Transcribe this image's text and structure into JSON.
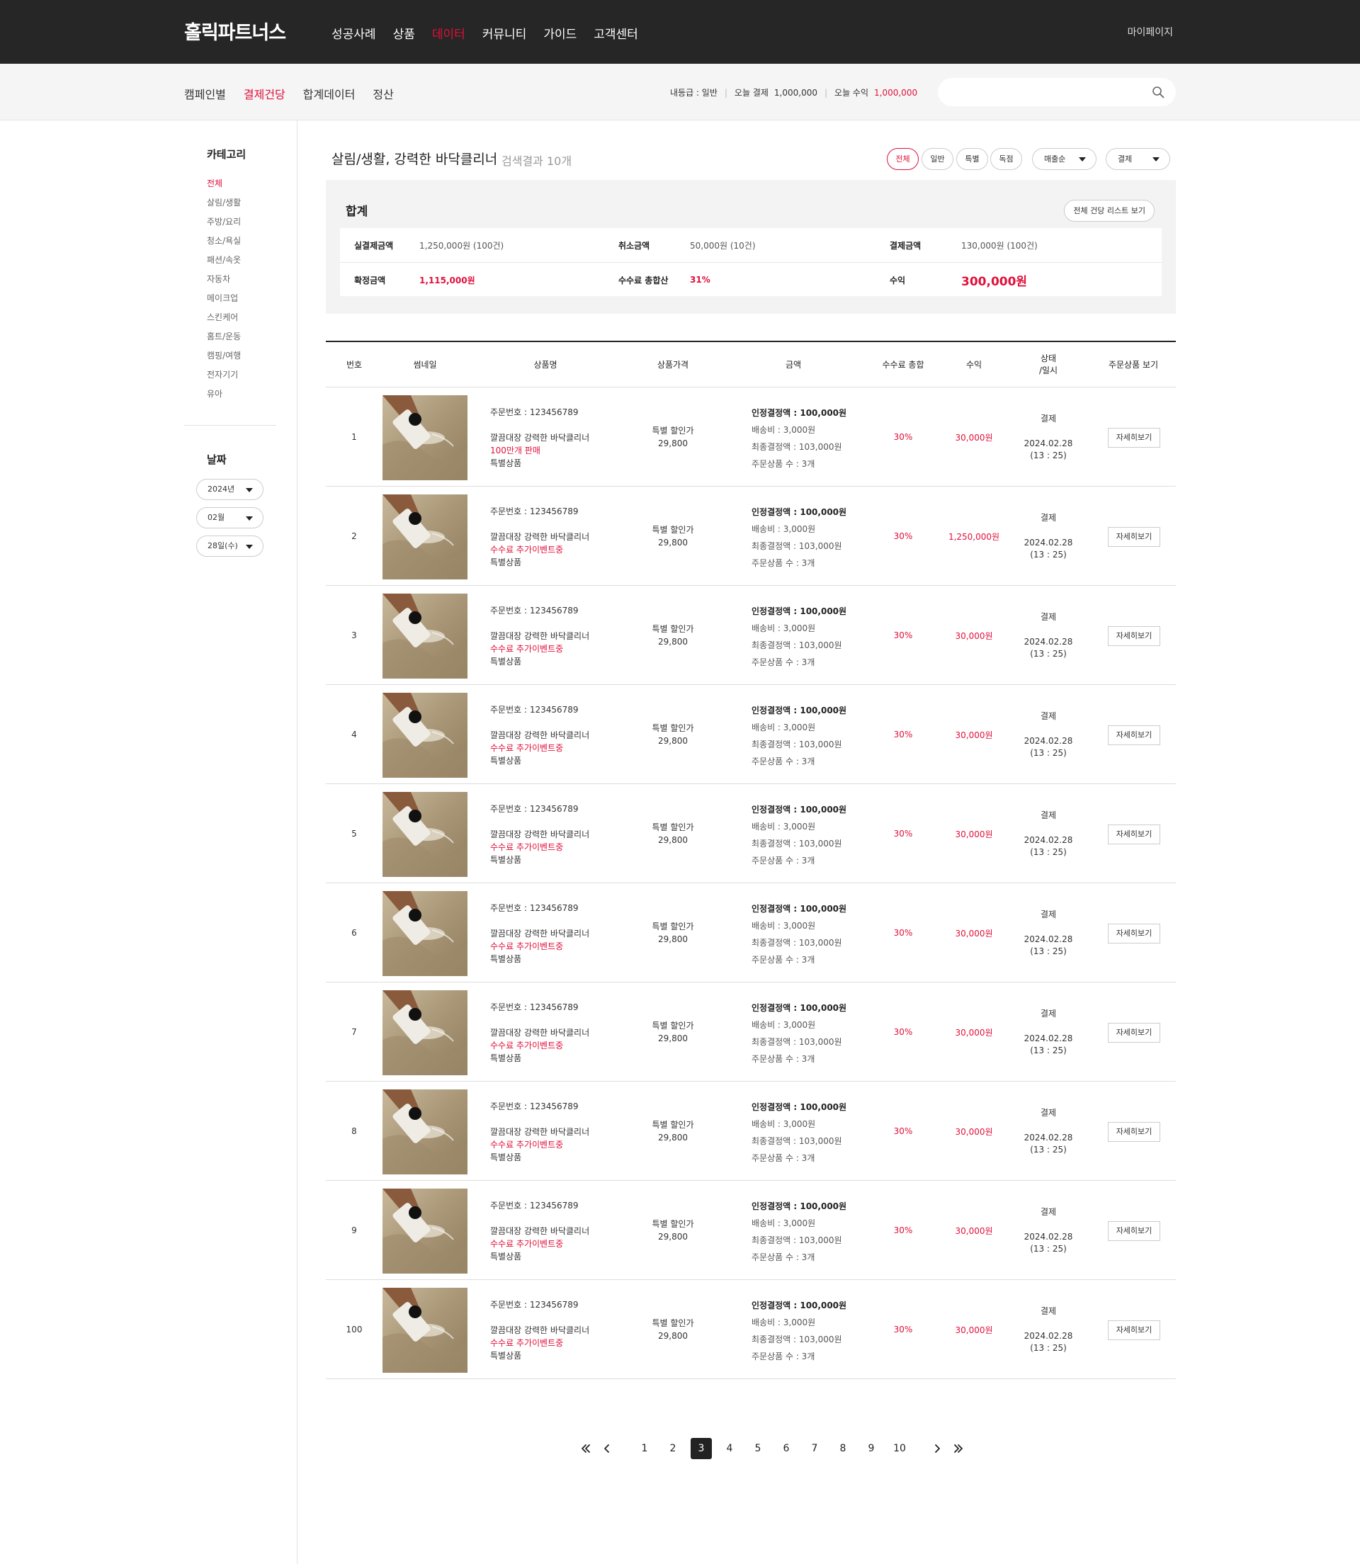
{
  "header": {
    "logo": "홀릭파트너스",
    "nav": [
      "성공사례",
      "상품",
      "데이터",
      "커뮤니티",
      "가이드",
      "고객센터"
    ],
    "active_nav": "데이터",
    "mypage": "마이페이지"
  },
  "subnav": {
    "tabs": [
      "캠페인별",
      "결제건당",
      "합계데이터",
      "정산"
    ],
    "active_tab": "결제건당",
    "grade_label": "내등급 : 일반",
    "payment_label": "오늘 결제",
    "payment_value": "1,000,000",
    "profit_label": "오늘 수익",
    "profit_value": "1,000,000",
    "search_placeholder": ""
  },
  "sidebar": {
    "category_title": "카테고리",
    "categories": [
      "전체",
      "살림/생활",
      "주방/요리",
      "청소/욕실",
      "패션/속옷",
      "자동차",
      "메이크업",
      "스킨케어",
      "홈트/운동",
      "캠핑/여행",
      "전자기기",
      "유아"
    ],
    "active_category": "전체",
    "date_title": "날짜",
    "year": "2024년",
    "month": "02월",
    "day": "28일(수)"
  },
  "main": {
    "title": "살림/생활, 강력한 바닥클리너",
    "result_count": "검색결과 10개",
    "filter_chips": [
      "전체",
      "일반",
      "특별",
      "독점"
    ],
    "active_chip": "전체",
    "sort_select": "매출순",
    "status_select": "결제"
  },
  "summary": {
    "title": "합계",
    "view_all_button": "전체 건당 리스트 보기",
    "actual_payment_label": "실결제금액",
    "actual_payment_value": "1,250,000원 (100건)",
    "cancel_label": "취소금액",
    "cancel_value": "50,000원 (10건)",
    "payment_label": "결제금액",
    "payment_value": "130,000원 (100건)",
    "confirmed_label": "확정금액",
    "confirmed_value": "1,115,000원",
    "commission_label": "수수료 총합산",
    "commission_value": "31%",
    "profit_label": "수익",
    "profit_value": "300,000원"
  },
  "table": {
    "headers": [
      "번호",
      "썸네일",
      "상품명",
      "상품가격",
      "금액",
      "수수료 총합",
      "수익",
      "상태\n/일시",
      "주문상품 보기"
    ],
    "rows": [
      {
        "no": "1",
        "order": "주문번호 : 123456789",
        "name": "깔끔대장 강력한 바닥클리너",
        "note": "100만개 판매",
        "type": "특별상품",
        "price_label": "특별 할인가",
        "price": "29,800",
        "approved_label": "인정결정액 : ",
        "approved": "100,000원",
        "shipping": "배송비 : 3,000원",
        "final": "최종결정액 : 103,000원",
        "qty": "주문상품 수 : 3개",
        "commission": "30%",
        "profit": "30,000원",
        "status": "결제",
        "date": "2024.02.28",
        "time": "(13 : 25)",
        "detail": "자세히보기"
      },
      {
        "no": "2",
        "order": "주문번호 : 123456789",
        "name": "깔끔대장 강력한 바닥클리너",
        "note": "수수료 추가이벤트중",
        "type": "특별상품",
        "price_label": "특별 할인가",
        "price": "29,800",
        "approved_label": "인정결정액 : ",
        "approved": "100,000원",
        "shipping": "배송비 : 3,000원",
        "final": "최종결정액 : 103,000원",
        "qty": "주문상품 수 : 3개",
        "commission": "30%",
        "profit": "1,250,000원",
        "status": "결제",
        "date": "2024.02.28",
        "time": "(13 : 25)",
        "detail": "자세히보기"
      },
      {
        "no": "3",
        "order": "주문번호 : 123456789",
        "name": "깔끔대장 강력한 바닥클리너",
        "note": "수수료 추가이벤트중",
        "type": "특별상품",
        "price_label": "특별 할인가",
        "price": "29,800",
        "approved_label": "인정결정액 : ",
        "approved": "100,000원",
        "shipping": "배송비 : 3,000원",
        "final": "최종결정액 : 103,000원",
        "qty": "주문상품 수 : 3개",
        "commission": "30%",
        "profit": "30,000원",
        "status": "결제",
        "date": "2024.02.28",
        "time": "(13 : 25)",
        "detail": "자세히보기"
      },
      {
        "no": "4",
        "order": "주문번호 : 123456789",
        "name": "깔끔대장 강력한 바닥클리너",
        "note": "수수료 추가이벤트중",
        "type": "특별상품",
        "price_label": "특별 할인가",
        "price": "29,800",
        "approved_label": "인정결정액 : ",
        "approved": "100,000원",
        "shipping": "배송비 : 3,000원",
        "final": "최종결정액 : 103,000원",
        "qty": "주문상품 수 : 3개",
        "commission": "30%",
        "profit": "30,000원",
        "status": "결제",
        "date": "2024.02.28",
        "time": "(13 : 25)",
        "detail": "자세히보기"
      },
      {
        "no": "5",
        "order": "주문번호 : 123456789",
        "name": "깔끔대장 강력한 바닥클리너",
        "note": "수수료 추가이벤트중",
        "type": "특별상품",
        "price_label": "특별 할인가",
        "price": "29,800",
        "approved_label": "인정결정액 : ",
        "approved": "100,000원",
        "shipping": "배송비 : 3,000원",
        "final": "최종결정액 : 103,000원",
        "qty": "주문상품 수 : 3개",
        "commission": "30%",
        "profit": "30,000원",
        "status": "결제",
        "date": "2024.02.28",
        "time": "(13 : 25)",
        "detail": "자세히보기"
      },
      {
        "no": "6",
        "order": "주문번호 : 123456789",
        "name": "깔끔대장 강력한 바닥클리너",
        "note": "수수료 추가이벤트중",
        "type": "특별상품",
        "price_label": "특별 할인가",
        "price": "29,800",
        "approved_label": "인정결정액 : ",
        "approved": "100,000원",
        "shipping": "배송비 : 3,000원",
        "final": "최종결정액 : 103,000원",
        "qty": "주문상품 수 : 3개",
        "commission": "30%",
        "profit": "30,000원",
        "status": "결제",
        "date": "2024.02.28",
        "time": "(13 : 25)",
        "detail": "자세히보기"
      },
      {
        "no": "7",
        "order": "주문번호 : 123456789",
        "name": "깔끔대장 강력한 바닥클리너",
        "note": "수수료 추가이벤트중",
        "type": "특별상품",
        "price_label": "특별 할인가",
        "price": "29,800",
        "approved_label": "인정결정액 : ",
        "approved": "100,000원",
        "shipping": "배송비 : 3,000원",
        "final": "최종결정액 : 103,000원",
        "qty": "주문상품 수 : 3개",
        "commission": "30%",
        "profit": "30,000원",
        "status": "결제",
        "date": "2024.02.28",
        "time": "(13 : 25)",
        "detail": "자세히보기"
      },
      {
        "no": "8",
        "order": "주문번호 : 123456789",
        "name": "깔끔대장 강력한 바닥클리너",
        "note": "수수료 추가이벤트중",
        "type": "특별상품",
        "price_label": "특별 할인가",
        "price": "29,800",
        "approved_label": "인정결정액 : ",
        "approved": "100,000원",
        "shipping": "배송비 : 3,000원",
        "final": "최종결정액 : 103,000원",
        "qty": "주문상품 수 : 3개",
        "commission": "30%",
        "profit": "30,000원",
        "status": "결제",
        "date": "2024.02.28",
        "time": "(13 : 25)",
        "detail": "자세히보기"
      },
      {
        "no": "9",
        "order": "주문번호 : 123456789",
        "name": "깔끔대장 강력한 바닥클리너",
        "note": "수수료 추가이벤트중",
        "type": "특별상품",
        "price_label": "특별 할인가",
        "price": "29,800",
        "approved_label": "인정결정액 : ",
        "approved": "100,000원",
        "shipping": "배송비 : 3,000원",
        "final": "최종결정액 : 103,000원",
        "qty": "주문상품 수 : 3개",
        "commission": "30%",
        "profit": "30,000원",
        "status": "결제",
        "date": "2024.02.28",
        "time": "(13 : 25)",
        "detail": "자세히보기"
      },
      {
        "no": "100",
        "order": "주문번호 : 123456789",
        "name": "깔끔대장 강력한 바닥클리너",
        "note": "수수료 추가이벤트중",
        "type": "특별상품",
        "price_label": "특별 할인가",
        "price": "29,800",
        "approved_label": "인정결정액 : ",
        "approved": "100,000원",
        "shipping": "배송비 : 3,000원",
        "final": "최종결정액 : 103,000원",
        "qty": "주문상품 수 : 3개",
        "commission": "30%",
        "profit": "30,000원",
        "status": "결제",
        "date": "2024.02.28",
        "time": "(13 : 25)",
        "detail": "자세히보기"
      }
    ]
  },
  "pagination": {
    "pages": [
      "1",
      "2",
      "3",
      "4",
      "5",
      "6",
      "7",
      "8",
      "9",
      "10"
    ],
    "current": "3"
  },
  "colors": {
    "accent": "#e0103a",
    "header_bg": "#262626",
    "subbar_bg": "#f5f5f5",
    "summary_bg": "#f3f3f3"
  },
  "icons": {
    "search": "search-icon",
    "first": "double-chevron-left-icon",
    "prev": "chevron-left-icon",
    "next": "chevron-right-icon",
    "last": "double-chevron-right-icon",
    "dropdown": "caret-down-icon"
  }
}
